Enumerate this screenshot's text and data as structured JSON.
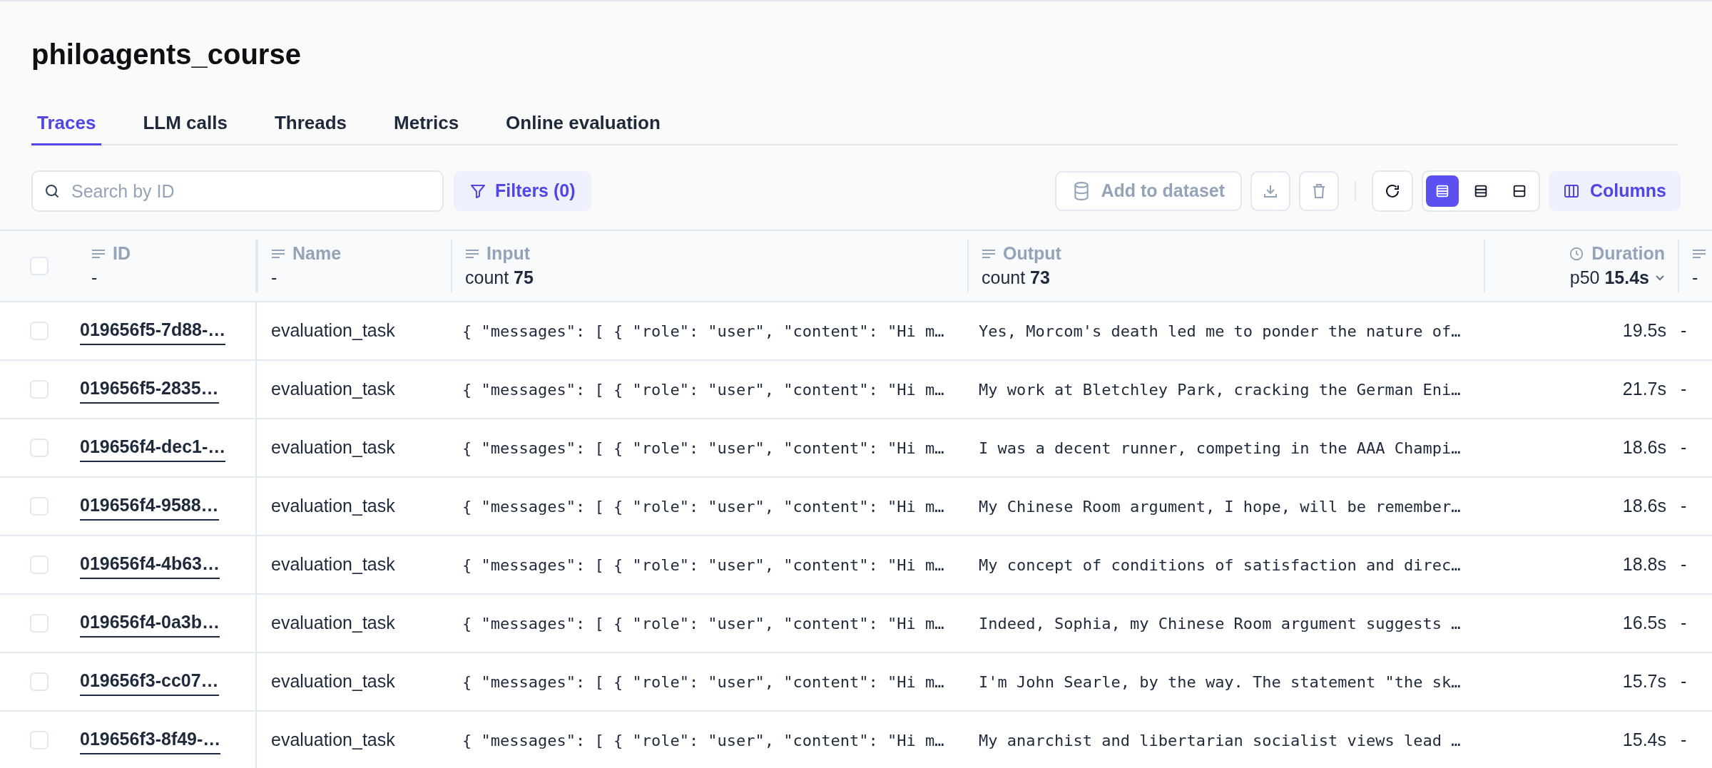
{
  "project": {
    "title": "philoagents_course"
  },
  "tabs": [
    {
      "label": "Traces",
      "selected": true
    },
    {
      "label": "LLM calls",
      "selected": false
    },
    {
      "label": "Threads",
      "selected": false
    },
    {
      "label": "Metrics",
      "selected": false
    },
    {
      "label": "Online evaluation",
      "selected": false
    }
  ],
  "toolbar": {
    "search": {
      "placeholder": "Search by ID"
    },
    "filters": "Filters (0)",
    "add_to_dataset": {
      "label": "Add to dataset",
      "disabled": true
    },
    "view_buttons": [
      {
        "kind": "compact",
        "selected": true
      },
      {
        "kind": "medium",
        "selected": false
      },
      {
        "kind": "tall",
        "selected": false
      }
    ],
    "columns": "Columns"
  },
  "table": {
    "all_selected": false,
    "columns": [
      {
        "label": "ID",
        "kind": "text",
        "summary": "-"
      },
      {
        "label": "Name",
        "kind": "text",
        "summary": "-"
      },
      {
        "label": "Input",
        "kind": "text",
        "summary_label": "count",
        "summary_value": "75"
      },
      {
        "label": "Output",
        "kind": "text",
        "summary_label": "count",
        "summary_value": "73"
      },
      {
        "label": "Duration",
        "kind": "duration",
        "summary_label": "p50",
        "summary_value": "15.4s",
        "sortable": true
      },
      {
        "kind": "text",
        "summary": "-"
      }
    ],
    "rows": [
      {
        "selected": false,
        "id": "019656f5-7d88-…",
        "name": "evaluation_task",
        "input": "{ \"messages\": [ { \"role\": \"user\", \"content\": \"Hi m…",
        "output": "Yes, Morcom's death led me to ponder the nature of…",
        "duration": "19.5s",
        "column_6": "-"
      },
      {
        "selected": false,
        "id": "019656f5-2835…",
        "name": "evaluation_task",
        "input": "{ \"messages\": [ { \"role\": \"user\", \"content\": \"Hi m…",
        "output": "My work at Bletchley Park, cracking the German Eni…",
        "duration": "21.7s",
        "column_6": "-"
      },
      {
        "selected": false,
        "id": "019656f4-dec1-…",
        "name": "evaluation_task",
        "input": "{ \"messages\": [ { \"role\": \"user\", \"content\": \"Hi m…",
        "output": "I was a decent runner, competing in the AAA Champi…",
        "duration": "18.6s",
        "column_6": "-"
      },
      {
        "selected": false,
        "id": "019656f4-9588…",
        "name": "evaluation_task",
        "input": "{ \"messages\": [ { \"role\": \"user\", \"content\": \"Hi m…",
        "output": "My Chinese Room argument, I hope, will be remember…",
        "duration": "18.6s",
        "column_6": "-"
      },
      {
        "selected": false,
        "id": "019656f4-4b63…",
        "name": "evaluation_task",
        "input": "{ \"messages\": [ { \"role\": \"user\", \"content\": \"Hi m…",
        "output": "My concept of conditions of satisfaction and direc…",
        "duration": "18.8s",
        "column_6": "-"
      },
      {
        "selected": false,
        "id": "019656f4-0a3b…",
        "name": "evaluation_task",
        "input": "{ \"messages\": [ { \"role\": \"user\", \"content\": \"Hi m…",
        "output": "Indeed, Sophia, my Chinese Room argument suggests …",
        "duration": "16.5s",
        "column_6": "-"
      },
      {
        "selected": false,
        "id": "019656f3-cc07…",
        "name": "evaluation_task",
        "input": "{ \"messages\": [ { \"role\": \"user\", \"content\": \"Hi m…",
        "output": "I'm John Searle, by the way. The statement \"the sk…",
        "duration": "15.7s",
        "column_6": "-"
      },
      {
        "selected": false,
        "id": "019656f3-8f49-…",
        "name": "evaluation_task",
        "input": "{ \"messages\": [ { \"role\": \"user\", \"content\": \"Hi m…",
        "output": "My anarchist and libertarian socialist views lead …",
        "duration": "15.4s",
        "column_6": "-"
      }
    ]
  }
}
